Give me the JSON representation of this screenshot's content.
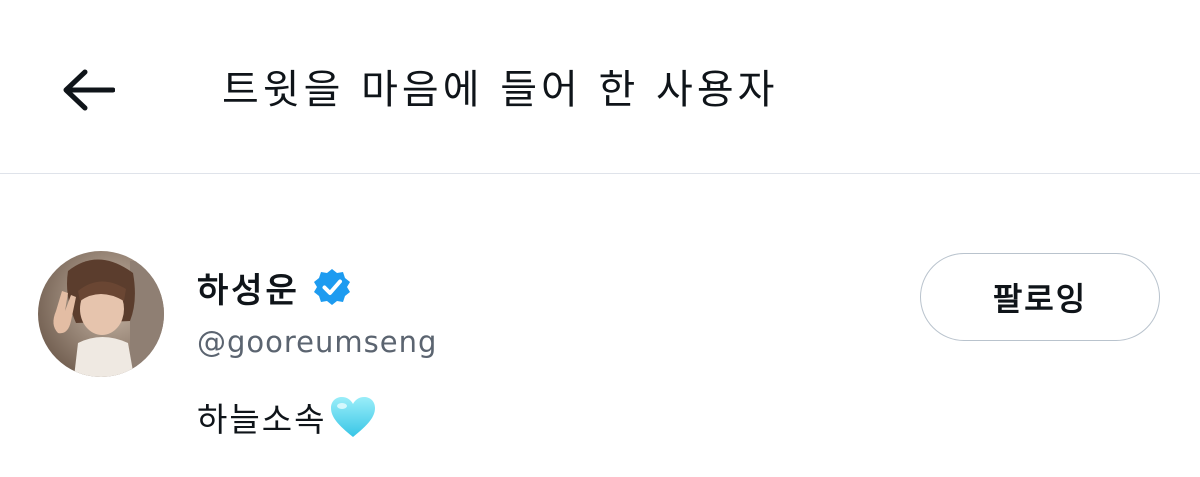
{
  "header": {
    "title": "트윗을 마음에 들어 한 사용자",
    "back_icon": "arrow-left-icon"
  },
  "users": [
    {
      "display_name": "하성운",
      "verified": true,
      "verified_icon": "verified-badge-icon",
      "verified_color": "#1d9bf0",
      "handle": "@gooreumseng",
      "bio": "하늘소속",
      "bio_emoji": "light-blue-heart-icon",
      "follow_label": "팔로잉"
    }
  ],
  "colors": {
    "divider": "#dfe3ea",
    "handle_text": "#5b6470",
    "button_border": "#b9c3cd",
    "heart": "#6fdcf2"
  }
}
